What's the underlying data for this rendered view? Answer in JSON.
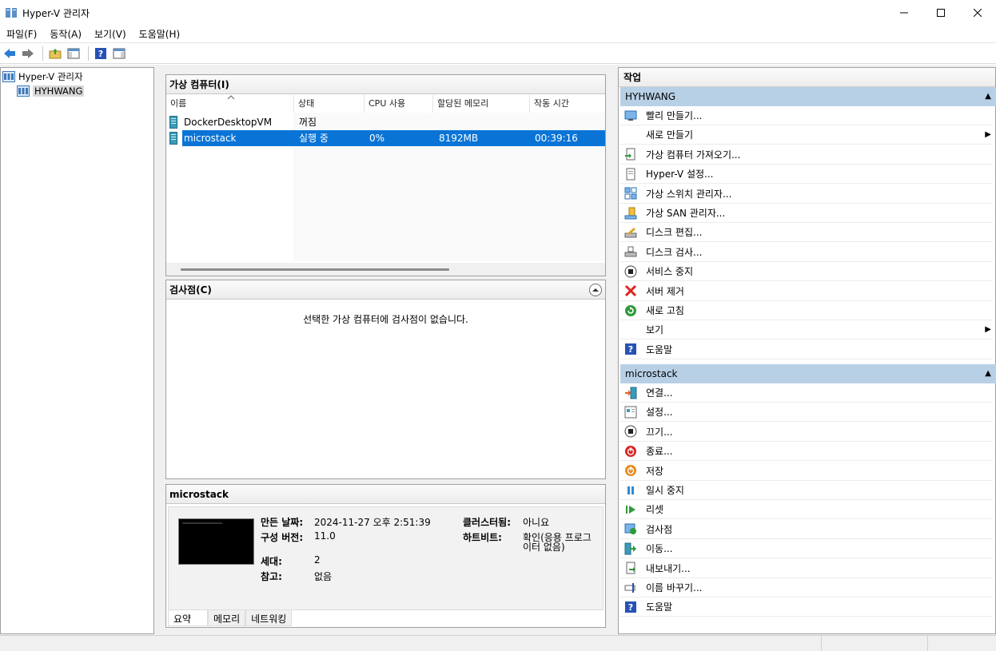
{
  "window": {
    "title": "Hyper-V 관리자"
  },
  "menu": [
    "파일(F)",
    "동작(A)",
    "보기(V)",
    "도움말(H)"
  ],
  "tree": {
    "root": "Hyper-V 관리자",
    "server": "HYHWANG"
  },
  "vm_pane": {
    "title": "가상 컴퓨터(I)",
    "columns": [
      "이름",
      "상태",
      "CPU 사용",
      "할당된 메모리",
      "작동 시간"
    ],
    "rows": [
      {
        "name": "DockerDesktopVM",
        "state": "꺼짐",
        "cpu": "",
        "memory": "",
        "uptime": "",
        "selected": false
      },
      {
        "name": "microstack",
        "state": "실행 중",
        "cpu": "0%",
        "memory": "8192MB",
        "uptime": "00:39:16",
        "selected": true
      }
    ]
  },
  "checkpoint_pane": {
    "title": "검사점(C)",
    "message": "선택한 가상 컴퓨터에 검사점이 없습니다."
  },
  "details": {
    "title": "microstack",
    "created_label": "만든 날짜:",
    "created_value": "2024-11-27 오후 2:51:39",
    "config_label": "구성 버전:",
    "config_value": "11.0",
    "gen_label": "세대:",
    "gen_value": "2",
    "notes_label": "참고:",
    "notes_value": "없음",
    "clustered_label": "클러스터됨:",
    "clustered_value": "아니요",
    "heartbeat_label": "하트비트:",
    "heartbeat_value_1": "확인(응용 프로그",
    "heartbeat_value_2": "이터 없음)",
    "tabs": [
      "요약",
      "메모리",
      "네트워킹"
    ]
  },
  "actions": {
    "title": "작업",
    "group1": {
      "name": "HYHWANG",
      "items": [
        {
          "label": "빨리 만들기...",
          "icon": "quick-create-icon"
        },
        {
          "label": "새로 만들기",
          "icon": "none",
          "submenu": true
        },
        {
          "label": "가상 컴퓨터 가져오기...",
          "icon": "import-vm-icon"
        },
        {
          "label": "Hyper-V 설정...",
          "icon": "settings-doc-icon"
        },
        {
          "label": "가상 스위치 관리자...",
          "icon": "virtual-switch-icon"
        },
        {
          "label": "가상 SAN 관리자...",
          "icon": "virtual-san-icon"
        },
        {
          "label": "디스크 편집...",
          "icon": "edit-disk-icon"
        },
        {
          "label": "디스크 검사...",
          "icon": "inspect-disk-icon"
        },
        {
          "label": "서비스 중지",
          "icon": "stop-service-icon"
        },
        {
          "label": "서버 제거",
          "icon": "remove-server-icon"
        },
        {
          "label": "새로 고침",
          "icon": "refresh-icon"
        },
        {
          "label": "보기",
          "icon": "none",
          "submenu": true
        },
        {
          "label": "도움말",
          "icon": "help-icon"
        }
      ]
    },
    "group2": {
      "name": "microstack",
      "items": [
        {
          "label": "연결...",
          "icon": "connect-icon"
        },
        {
          "label": "설정...",
          "icon": "settings-icon"
        },
        {
          "label": "끄기...",
          "icon": "turn-off-icon"
        },
        {
          "label": "종료...",
          "icon": "shutdown-icon"
        },
        {
          "label": "저장",
          "icon": "save-icon"
        },
        {
          "label": "일시 중지",
          "icon": "pause-icon"
        },
        {
          "label": "리셋",
          "icon": "reset-icon"
        },
        {
          "label": "검사점",
          "icon": "checkpoint-icon"
        },
        {
          "label": "이동...",
          "icon": "move-icon"
        },
        {
          "label": "내보내기...",
          "icon": "export-icon"
        },
        {
          "label": "이름 바꾸기...",
          "icon": "rename-icon"
        },
        {
          "label": "도움말",
          "icon": "help-icon"
        }
      ]
    }
  },
  "colors": {
    "selection": "#0a74d6",
    "group_header": "#b8d0e6"
  }
}
